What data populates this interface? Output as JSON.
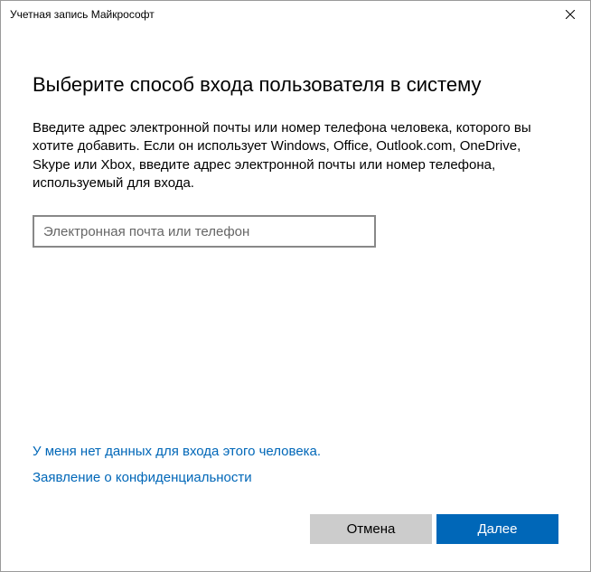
{
  "titlebar": {
    "title": "Учетная запись Майкрософт"
  },
  "main": {
    "heading": "Выберите способ входа пользователя в систему",
    "description": "Введите адрес электронной почты или номер телефона человека, которого вы хотите добавить. Если он использует Windows, Office, Outlook.com, OneDrive, Skype или Xbox, введите адрес электронной почты или номер телефона, используемый для входа.",
    "input_placeholder": "Электронная почта или телефон",
    "input_value": ""
  },
  "links": {
    "no_credentials": "У меня нет данных для входа этого человека.",
    "privacy": "Заявление о конфиденциальности"
  },
  "footer": {
    "cancel": "Отмена",
    "next": "Далее"
  }
}
